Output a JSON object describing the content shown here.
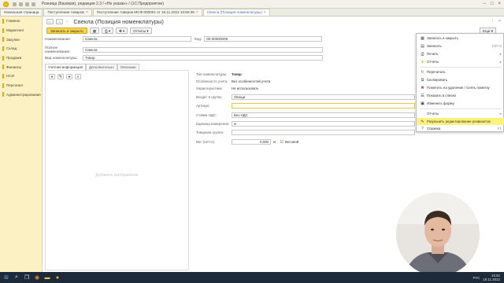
{
  "window": {
    "title": "Розница (Базовая), редакция 2.3 / «Не указан» / (1С:Предприятие)"
  },
  "tabs": [
    {
      "label": "Начальная страница",
      "active": false,
      "closable": false
    },
    {
      "label": "Поступление товаров",
      "active": false,
      "closable": true
    },
    {
      "label": "Поступление товаров МСФ-000001 от 19.11.2022 10:50:39",
      "active": false,
      "closable": true
    },
    {
      "label": "Свекла (Позиция номенклатуры)",
      "active": true,
      "closable": true
    }
  ],
  "sidebar": {
    "items": [
      {
        "label": "Главное"
      },
      {
        "label": "Маркетинг"
      },
      {
        "label": "Закупки"
      },
      {
        "label": "Склад"
      },
      {
        "label": "Продажи"
      },
      {
        "label": "Финансы"
      },
      {
        "label": "НСИ"
      },
      {
        "label": "Персонал"
      },
      {
        "label": "Администрирование"
      }
    ]
  },
  "form": {
    "title": "Свекла (Позиция номенклатуры)",
    "save_close_label": "Записать и закрыть",
    "reports_label": "Отчеты",
    "more_label": "Еще",
    "name_label": "Наименование:",
    "name_value": "Свекла",
    "code_label": "Код:",
    "code_value": "00-00000009",
    "fullname_label": "Полное наименование:",
    "fullname_value": "Свекла",
    "kind_label": "Вид номенклатуры:",
    "kind_value": "Товар",
    "content_tabs": [
      "Учетная информация",
      "Дополнительно",
      "Описание"
    ],
    "image_placeholder": "Добавить изображение",
    "props": {
      "type_label": "Тип номенклатуры:",
      "type_value": "Товар",
      "feature_label": "Особенность учета:",
      "feature_value": "Без особенностей учета",
      "chars_label": "Характеристики:",
      "chars_value": "Не использовать",
      "group_label": "Входит в группу:",
      "group_value": "Овощи",
      "article_label": "Артикул:",
      "article_value": "",
      "vat_label": "Ставка НДС:",
      "vat_value": "Без НДС",
      "unit_label": "Единица измерения:",
      "unit_value": "кг",
      "goods_group_label": "Товарная группа:",
      "goods_group_value": "",
      "weight_label": "Вес (нетто):",
      "weight_value": "0,000",
      "weight_unit": "кг",
      "weighted_label": "Весовой"
    }
  },
  "menu": {
    "items": [
      {
        "label": "Записать и закрыть",
        "icon": "save-close-icon",
        "shortcut": ""
      },
      {
        "label": "Записать",
        "icon": "save-icon",
        "shortcut": "Ctrl+S"
      },
      {
        "label": "Печать",
        "icon": "print-icon",
        "shortcut": ""
      },
      {
        "label": "Отчеты",
        "icon": "reports-icon",
        "shortcut": ""
      },
      {
        "label": "Перечитать",
        "icon": "refresh-icon",
        "shortcut": ""
      },
      {
        "label": "Скопировать",
        "icon": "copy-icon",
        "shortcut": ""
      },
      {
        "label": "Пометить на удаление / Снять пометку",
        "icon": "delete-mark-icon",
        "shortcut": ""
      },
      {
        "label": "Показать в списке",
        "icon": "show-list-icon",
        "shortcut": ""
      },
      {
        "label": "Изменить форму",
        "icon": "edit-form-icon",
        "shortcut": ""
      },
      {
        "label": "Отчеты",
        "icon": "reports-icon",
        "shortcut": ""
      },
      {
        "label": "Разрешить редактирование реквизитов",
        "icon": "unlock-icon",
        "shortcut": ""
      },
      {
        "label": "Справка",
        "icon": "help-icon",
        "shortcut": "F1"
      }
    ]
  },
  "taskbar": {
    "lang": "РУС",
    "time": "15:52",
    "date": "19.11.2022"
  },
  "colors": {
    "sidebar_bg": "#fbf1c3",
    "primary_button": "#f7d24a",
    "highlight": "#fff27a",
    "taskbar": "#1c2a3a"
  }
}
